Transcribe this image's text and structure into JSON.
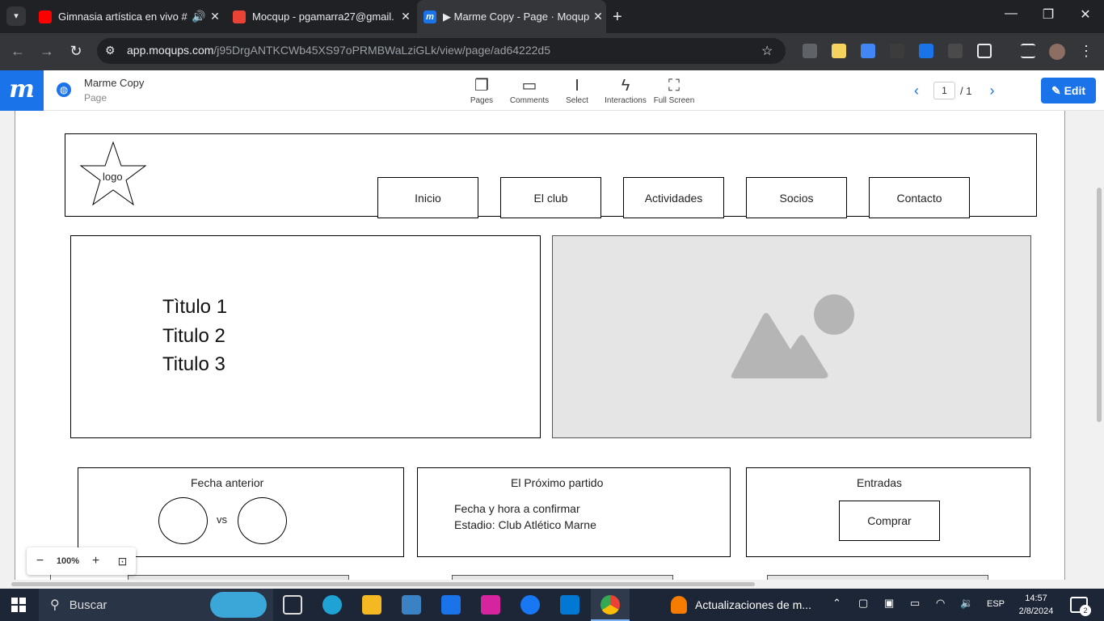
{
  "browser": {
    "tabs": [
      {
        "title": "Gimnasia artística en vivo #",
        "icon": "youtube-icon",
        "color": "#ff0000"
      },
      {
        "title": "Mocqup - pgamarra27@gmail.",
        "icon": "gmail-icon",
        "color": "#ea4335"
      },
      {
        "title": "▶ Marme Copy - Page · Moqup",
        "icon": "moqups-icon",
        "color": "#1a73e8"
      }
    ],
    "url_host": "app.moqups.com",
    "url_path": "/j95DrgANTKCWb45XS97oPRMBWaLziGLk/view/page/ad64222d5"
  },
  "app": {
    "logo": "m",
    "doc_title": "Marme Copy",
    "doc_subtitle": "Page",
    "toolbar": [
      {
        "label": "Pages",
        "icon": "pages-icon"
      },
      {
        "label": "Comments",
        "icon": "comments-icon"
      },
      {
        "label": "Select",
        "icon": "select-icon"
      },
      {
        "label": "Interactions",
        "icon": "interactions-icon"
      },
      {
        "label": "Full Screen",
        "icon": "fullscreen-icon"
      }
    ],
    "page_current": "1",
    "page_total": "/ 1",
    "edit_label": "Edit"
  },
  "mockup": {
    "logo_text": "logo",
    "nav": [
      "Inicio",
      "El club",
      "Actividades",
      "Socios",
      "Contacto"
    ],
    "titles": [
      "Tìtulo 1",
      "Titulo 2",
      "Titulo 3"
    ],
    "sections": {
      "previous": {
        "title": "Fecha anterior",
        "vs": "vs"
      },
      "next": {
        "title": "El Próximo partido",
        "line1": "Fecha y hora a confirmar",
        "line2": "Estadio: Club Atlético Marne"
      },
      "tickets": {
        "title": "Entradas",
        "button": "Comprar"
      }
    }
  },
  "zoom": {
    "level": "100%",
    "minus": "−",
    "plus": "+"
  },
  "taskbar": {
    "search_label": "Buscar",
    "notification": "Actualizaciones de m...",
    "lang": "ESP",
    "time": "14:57",
    "date": "2/8/2024",
    "badge": "2"
  }
}
